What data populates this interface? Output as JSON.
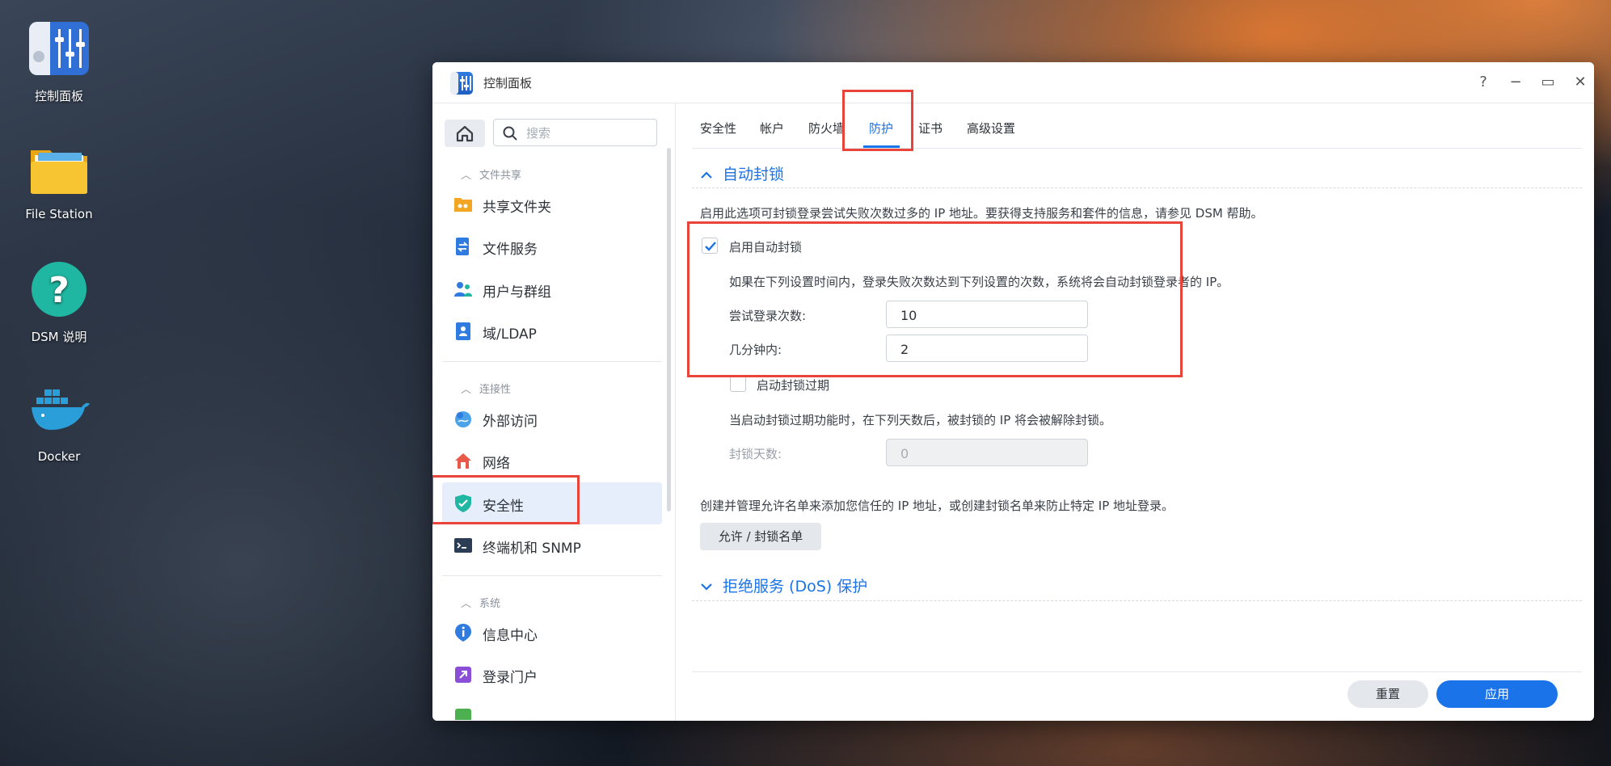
{
  "desktop": {
    "icons": [
      {
        "label": "控制面板",
        "icon": "control-panel-icon"
      },
      {
        "label": "File Station",
        "icon": "folder-icon"
      },
      {
        "label": "DSM 说明",
        "icon": "help-icon"
      },
      {
        "label": "Docker",
        "icon": "docker-whale-icon"
      }
    ]
  },
  "window": {
    "title": "控制面板",
    "controls": {
      "help": "?",
      "minimize": "−",
      "maximize": "▭",
      "close": "✕"
    }
  },
  "sidebar": {
    "search_placeholder": "搜索",
    "sections": [
      {
        "title": "文件共享",
        "items": [
          {
            "label": "共享文件夹",
            "icon": "shared-folder-icon"
          },
          {
            "label": "文件服务",
            "icon": "file-services-icon"
          },
          {
            "label": "用户与群组",
            "icon": "users-groups-icon"
          },
          {
            "label": "域/LDAP",
            "icon": "domain-ldap-icon"
          }
        ]
      },
      {
        "title": "连接性",
        "items": [
          {
            "label": "外部访问",
            "icon": "external-access-icon"
          },
          {
            "label": "网络",
            "icon": "network-icon"
          },
          {
            "label": "安全性",
            "icon": "shield-icon",
            "active": true
          },
          {
            "label": "终端机和 SNMP",
            "icon": "terminal-icon"
          }
        ]
      },
      {
        "title": "系统",
        "items": [
          {
            "label": "信息中心",
            "icon": "info-center-icon"
          },
          {
            "label": "登录门户",
            "icon": "login-portal-icon"
          }
        ]
      }
    ]
  },
  "tabs": [
    {
      "label": "安全性"
    },
    {
      "label": "帐户"
    },
    {
      "label": "防火墙"
    },
    {
      "label": "防护",
      "active": true
    },
    {
      "label": "证书"
    },
    {
      "label": "高级设置"
    }
  ],
  "auto_block": {
    "title": "自动封锁",
    "description": "启用此选项可封锁登录尝试失败次数过多的 IP 地址。要获得支持服务和套件的信息，请参见 DSM 帮助。",
    "enable_label": "启用自动封锁",
    "enable_checked": true,
    "rule_text": "如果在下列设置时间内，登录失败次数达到下列设置的次数，系统将会自动封锁登录者的 IP。",
    "attempts_label": "尝试登录次数:",
    "attempts_value": "10",
    "minutes_label": "几分钟内:",
    "minutes_value": "2",
    "expire_label": "启动封锁过期",
    "expire_checked": false,
    "expire_text": "当启动封锁过期功能时，在下列天数后，被封锁的 IP 将会被解除封锁。",
    "days_label": "封锁天数:",
    "days_value": "0",
    "allow_block_text": "创建并管理允许名单来添加您信任的 IP 地址，或创建封锁名单来防止特定 IP 地址登录。",
    "allow_block_button": "允许 / 封锁名单"
  },
  "dos": {
    "title": "拒绝服务 (DoS) 保护"
  },
  "footer": {
    "reset": "重置",
    "apply": "应用"
  },
  "colors": {
    "accent": "#1a73e8",
    "highlight_box": "#e8443a",
    "active_nav_bg": "#e6eefb"
  }
}
